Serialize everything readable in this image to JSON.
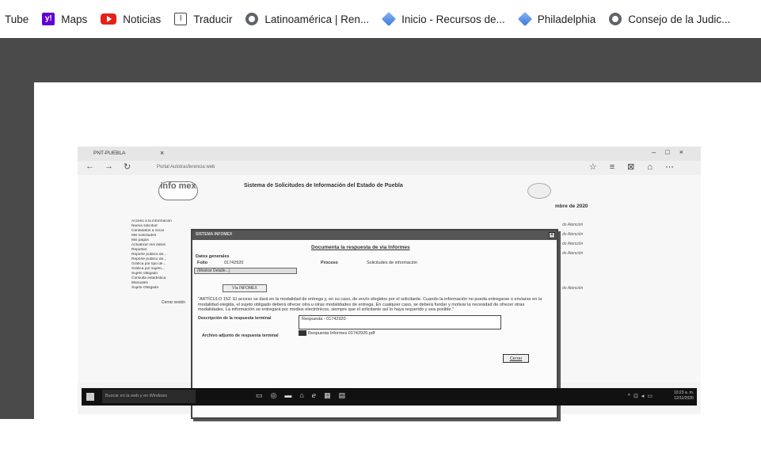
{
  "bookmarks": [
    {
      "label": "Tube",
      "icon": "none"
    },
    {
      "label": "Maps",
      "icon": "yahoo-icon"
    },
    {
      "label": "Noticias",
      "icon": "youtube-icon"
    },
    {
      "label": "Traducir",
      "icon": "translate-icon"
    },
    {
      "label": "Latinoamérica | Ren...",
      "icon": "globe-icon"
    },
    {
      "label": "Inicio - Recursos de...",
      "icon": "cube-icon"
    },
    {
      "label": "Philadelphia",
      "icon": "cube-icon"
    },
    {
      "label": "Consejo de la Judic...",
      "icon": "globe-icon"
    }
  ],
  "scan": {
    "tab_title": "PNT-PUEBLA",
    "url": "Portal Autotrasferencia web",
    "site_title": "Sistema de Solicitudes de Información del Estado de Puebla",
    "logo_text": "info mex",
    "right_date": "mbre de 2020",
    "menu_items": [
      "Acceso a la información",
      "Nueva solicitud",
      "Candidatos a vocal",
      "Mis solicitudes",
      "Mis pagos",
      "Actualizar mis datos",
      "Reportes",
      "Reporte público de...",
      "Reporte público de...",
      "Gráfica por tipo de...",
      "Gráfica por sujeto...",
      "Sujeto obligado",
      "Consulta estadística",
      "Manuales",
      "Sujeto Obligado"
    ],
    "logout": "Cerrar sesión",
    "right_links": [
      "do Atención",
      "do Atención",
      "do Atención",
      "do Atención",
      "do Atención"
    ],
    "dialog": {
      "header": "SISTEMA INFOMEX",
      "title": "Documenta la respuesta de via Informes",
      "section": "Datos generales",
      "folio_label": "Folio",
      "folio_value": "01742920",
      "proceso_label": "Proceso",
      "proceso_value": "Solicitudes de información",
      "detail_btn": "(Mostrar Detalle...)",
      "via_btn": "Vía INFOMEX",
      "article": "\"ARTÍCULO 152. El acceso se dará en la modalidad de entrega y, en su caso, de envío elegidos por el solicitante. Cuando la información no pueda entregarse o enviarse en la modalidad elegida, el sujeto obligado deberá ofrecer otra u otras modalidades de entrega. En cualquier caso, se deberá fundar y motivar la necesidad de ofrecer otras modalidades. La información se entregará por medios electrónicos, siempre que el solicitante así lo haya requerido y sea posible.\"",
      "desc_label": "Descripción de la respuesta terminal",
      "desc_value": "Respuesta - 01742920",
      "attach_label": "Archivo adjunto de respuesta terminal",
      "attach_value": "Respuesta Informes 01742920.pdf",
      "close_btn": "Cerrar"
    },
    "taskbar": {
      "search": "Buscar en la web y en Windows",
      "time": "10:23 a. m.",
      "date": "12/11/2020"
    }
  }
}
